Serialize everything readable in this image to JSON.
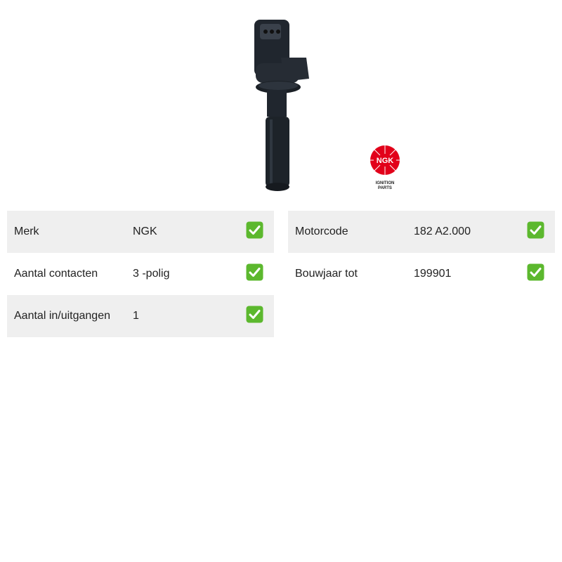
{
  "product": {
    "image_icon": "ignition-coil-image",
    "logo": {
      "text": "NGK",
      "tagline_line1": "IGNITION",
      "tagline_line2": "PARTS",
      "color": "#e2001a"
    }
  },
  "specs_left": [
    {
      "label": "Merk",
      "value": "NGK",
      "status_icon": "check-icon"
    },
    {
      "label": "Aantal contacten",
      "value": "3 -polig",
      "status_icon": "check-icon"
    },
    {
      "label": "Aantal in/uitgangen",
      "value": "1",
      "status_icon": "check-icon"
    }
  ],
  "specs_right": [
    {
      "label": "Motorcode",
      "value": "182 A2.000",
      "status_icon": "check-icon"
    },
    {
      "label": "Bouwjaar tot",
      "value": "199901",
      "status_icon": "check-icon"
    }
  ],
  "colors": {
    "row_shade": "#efefef",
    "check_green": "#5cb82e"
  }
}
